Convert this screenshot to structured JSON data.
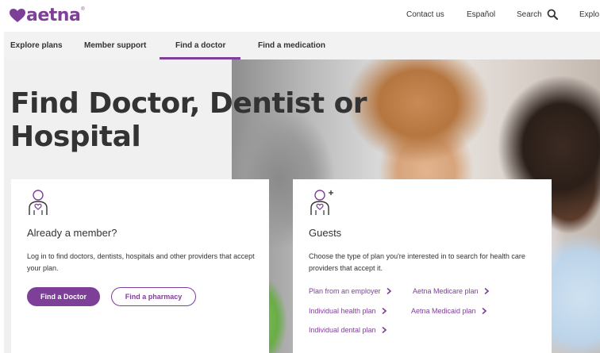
{
  "header": {
    "logo_text": "aetna",
    "logo_mark": "®",
    "links": [
      "Contact us",
      "Español",
      "Search",
      "Explo"
    ]
  },
  "nav": {
    "items": [
      "Explore plans",
      "Member support",
      "Find a doctor",
      "Find a medication"
    ],
    "active": "Find a doctor"
  },
  "hero": {
    "title_line1": "Find Doctor, Dentist or",
    "title_line2": "Hospital"
  },
  "member_card": {
    "icon": "member-person-heart-icon",
    "heading": "Already a member?",
    "text": "Log in to find doctors, dentists, hospitals and other providers that accept your plan.",
    "primary_button": "Find a Doctor",
    "secondary_button": "Find a pharmacy"
  },
  "guest_card": {
    "icon": "guest-person-plus-icon",
    "heading": "Guests",
    "text": "Choose the type of plan you're interested in to search for health care providers that accept it.",
    "links": [
      "Plan from an employer",
      "Aetna Medicare plan",
      "Individual health plan",
      "Aetna Medicaid plan",
      "Individual dental plan"
    ]
  },
  "colors": {
    "brand_purple": "#7d3f98",
    "text": "#333333",
    "nav_bg": "#f2f2f2"
  }
}
